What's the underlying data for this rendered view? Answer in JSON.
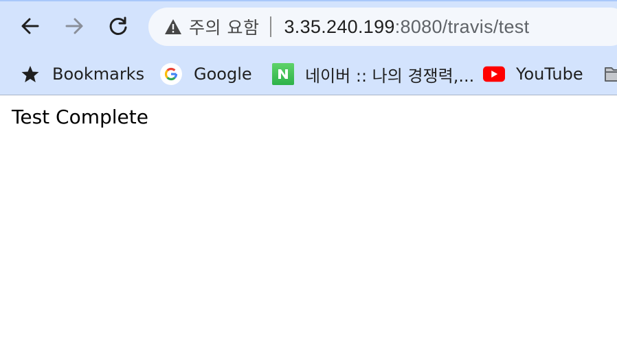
{
  "toolbar": {
    "back_icon": "arrow-left-icon",
    "forward_icon": "arrow-right-icon",
    "reload_icon": "reload-icon"
  },
  "omnibox": {
    "security_icon": "warning-triangle-icon",
    "security_label": "주의 요함",
    "url_host": "3.35.240.199",
    "url_rest": ":8080/travis/test"
  },
  "bookmarks": [
    {
      "label": "Bookmarks",
      "icon": "star-icon"
    },
    {
      "label": "Google",
      "icon": "google-logo-icon"
    },
    {
      "label": "네이버 :: 나의 경쟁력,...",
      "icon": "naver-logo-icon"
    },
    {
      "label": "YouTube",
      "icon": "youtube-logo-icon"
    },
    {
      "label": "",
      "icon": "folder-icon"
    }
  ],
  "page": {
    "text": "Test Complete"
  },
  "colors": {
    "chrome_bg": "#d3e3fd",
    "omnibox_bg": "#f4f7fc",
    "naver_green": "#03c75a",
    "youtube_red": "#ff0000"
  }
}
